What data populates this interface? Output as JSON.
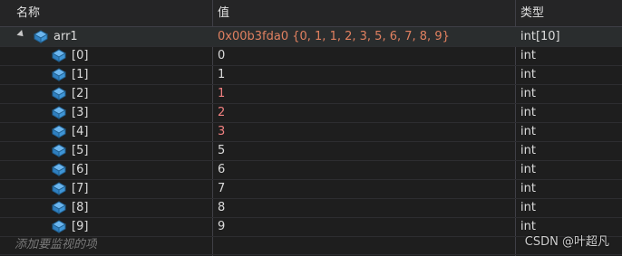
{
  "headers": {
    "name": "名称",
    "value": "值",
    "type": "类型"
  },
  "parent": {
    "name": "arr1",
    "value": "0x00b3fda0 {0, 1, 1, 2, 3, 5, 6, 7, 8, 9}",
    "type": "int[10]"
  },
  "items": [
    {
      "name": "[0]",
      "value": "0",
      "type": "int",
      "changed": false
    },
    {
      "name": "[1]",
      "value": "1",
      "type": "int",
      "changed": false
    },
    {
      "name": "[2]",
      "value": "1",
      "type": "int",
      "changed": true
    },
    {
      "name": "[3]",
      "value": "2",
      "type": "int",
      "changed": true
    },
    {
      "name": "[4]",
      "value": "3",
      "type": "int",
      "changed": true
    },
    {
      "name": "[5]",
      "value": "5",
      "type": "int",
      "changed": false
    },
    {
      "name": "[6]",
      "value": "6",
      "type": "int",
      "changed": false
    },
    {
      "name": "[7]",
      "value": "7",
      "type": "int",
      "changed": false
    },
    {
      "name": "[8]",
      "value": "8",
      "type": "int",
      "changed": false
    },
    {
      "name": "[9]",
      "value": "9",
      "type": "int",
      "changed": false
    }
  ],
  "add_watch_placeholder": "添加要监视的项",
  "watermark": "CSDN @叶超凡",
  "colors": {
    "changed_value": "#f08080",
    "parent_value": "#e08060",
    "icon": "#4aa3df"
  }
}
